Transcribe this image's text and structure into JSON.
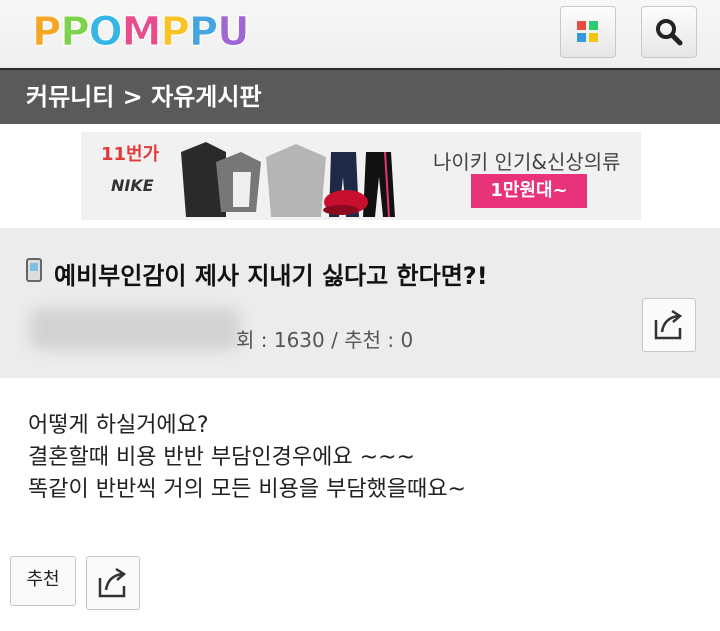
{
  "header": {
    "logo_text": "PPOMPPU",
    "logo_colors": [
      "#f5a623",
      "#7fd24b",
      "#35b6e6",
      "#e84c8b",
      "#f7c325",
      "#45a5e0",
      "#a066d3"
    ],
    "apps_icon": "grid-icon",
    "search_icon": "search-icon"
  },
  "breadcrumb": {
    "text": "커뮤니티 > 자유게시판"
  },
  "banner": {
    "store": "11번가",
    "brand": "NIKE",
    "headline": "나이키 인기&신상의류",
    "badge": "1만원대~",
    "badge_color": "#e8327a"
  },
  "post": {
    "title": "예비부인감이 제사 지내기 싫다고 한다면?!",
    "meta": "회 : 1630 / 추천 : 0",
    "body": [
      "어떻게 하실거에요?",
      "결혼할때 비용 반반 부담인경우에요 ~~~",
      "똑같이 반반씩 거의 모든 비용을 부담했을때요~"
    ]
  },
  "actions": {
    "recommend_label": "추천",
    "share_icon": "share-icon"
  }
}
